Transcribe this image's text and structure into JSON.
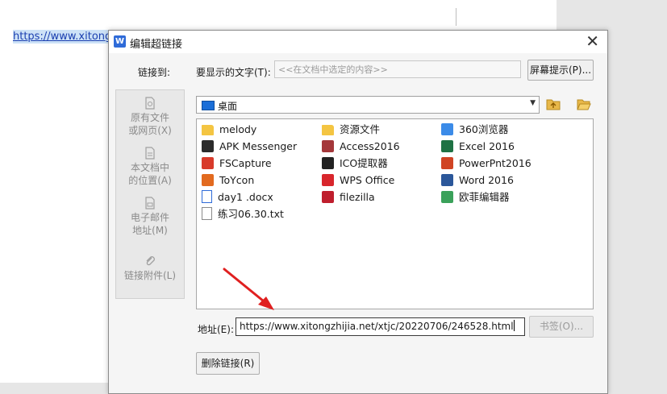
{
  "document": {
    "link_text": "https://www.xitongz"
  },
  "dialog": {
    "title": "编辑超链接",
    "close_icon": "close-icon",
    "link_to_label": "链接到:",
    "display_text_label": "要显示的文字(T):",
    "display_text_placeholder": "<<在文档中选定的内容>>",
    "screentip_button": "屏幕提示(P)...",
    "nav_items": [
      {
        "label_line1": "原有文件",
        "label_line2": "或网页(X)",
        "icon": "file-web-icon"
      },
      {
        "label_line1": "本文档中",
        "label_line2": "的位置(A)",
        "icon": "document-place-icon"
      },
      {
        "label_line1": "电子邮件",
        "label_line2": "地址(M)",
        "icon": "email-icon"
      },
      {
        "label_line1": "链接附件(L)",
        "label_line2": "",
        "icon": "paperclip-icon"
      }
    ],
    "location": {
      "value": "桌面",
      "icon": "desktop-icon"
    },
    "files": [
      {
        "name": "melody",
        "icon": "folder-icon",
        "color": "#f4c542"
      },
      {
        "name": "资源文件",
        "icon": "folder-icon",
        "color": "#f4c542"
      },
      {
        "name": "360浏览器",
        "icon": "browser-360-icon",
        "color": "#3b8be8"
      },
      {
        "name": "APK Messenger",
        "icon": "apk-messenger-icon",
        "color": "#2b2b2b"
      },
      {
        "name": "Access2016",
        "icon": "access-icon",
        "color": "#a4373a"
      },
      {
        "name": "Excel 2016",
        "icon": "excel-icon",
        "color": "#1f7244"
      },
      {
        "name": "FSCapture",
        "icon": "fscapture-icon",
        "color": "#d83b2b"
      },
      {
        "name": "ICO提取器",
        "icon": "ico-extractor-icon",
        "color": "#222222"
      },
      {
        "name": "PowerPnt2016",
        "icon": "powerpoint-icon",
        "color": "#d04423"
      },
      {
        "name": "ToYcon",
        "icon": "toycon-icon",
        "color": "#e26a1f"
      },
      {
        "name": "WPS Office",
        "icon": "wps-icon",
        "color": "#d8262c"
      },
      {
        "name": "Word 2016",
        "icon": "word-icon",
        "color": "#2b579a"
      },
      {
        "name": "day1 .docx",
        "icon": "docx-icon",
        "color": "#2f6bd8"
      },
      {
        "name": "filezilla",
        "icon": "filezilla-icon",
        "color": "#bf1e2d"
      },
      {
        "name": "欧菲编辑器",
        "icon": "editor-icon",
        "color": "#3aa15a"
      },
      {
        "name": "练习06.30.txt",
        "icon": "txt-icon",
        "color": "#8a8a8a"
      }
    ],
    "address_label": "地址(E):",
    "address_value": "https://www.xitongzhijia.net/xtjc/20220706/246528.html",
    "bookmark_button": "书签(O)...",
    "remove_link_button": "删除链接(R)"
  },
  "colors": {
    "link": "#1b3fb0",
    "arrow": "#e02020"
  }
}
